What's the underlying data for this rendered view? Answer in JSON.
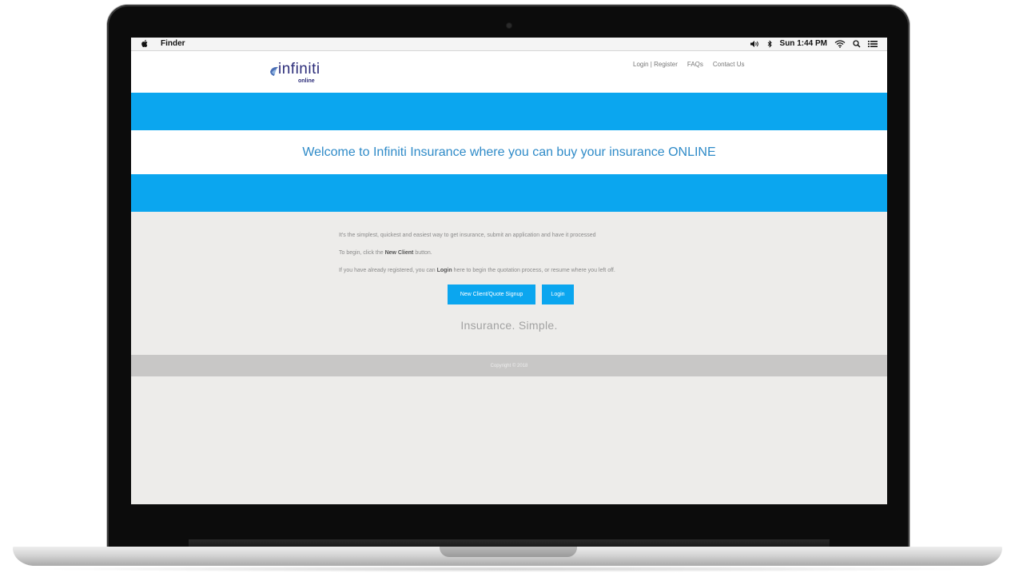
{
  "menubar": {
    "app_name": "Finder",
    "clock": "Sun 1:44 PM",
    "icons": [
      "apple-icon",
      "volume-icon",
      "bluetooth-icon",
      "wifi-icon",
      "spotlight-search-icon",
      "notification-list-icon"
    ]
  },
  "site": {
    "logo_text": "infiniti",
    "logo_sub": "online",
    "nav": {
      "login_register": "Login | Register",
      "faqs": "FAQs",
      "contact": "Contact Us"
    },
    "welcome": "Welcome to Infiniti Insurance where you can buy your insurance ONLINE",
    "intro_line": "It's the simplest, quickest and easiest way to get insurance, submit an application and have it processed",
    "begin_prefix": "To begin, click the ",
    "begin_bold": "New Client",
    "begin_suffix": " button.",
    "registered_prefix": "If you have already registered, you can ",
    "registered_bold": "Login",
    "registered_suffix": " here to begin the quotation process, or resume where you left off.",
    "buttons": {
      "new_client": "New Client/Quote Signup",
      "login": "Login"
    },
    "tagline": "Insurance. Simple.",
    "footer": "Copyright © 2018"
  },
  "colors": {
    "accent_blue": "#0ba6ef",
    "welcome_text": "#2f8bc8",
    "logo_navy": "#2d2e7a",
    "page_bg": "#edecea",
    "footer_bg": "#c8c7c6"
  }
}
